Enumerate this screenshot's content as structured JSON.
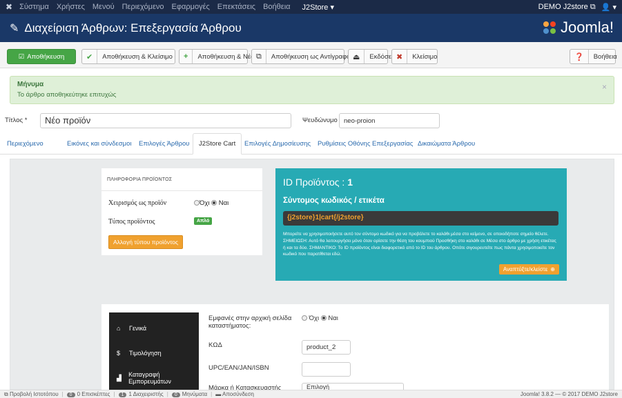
{
  "topnav": {
    "items": [
      "Σύστημα",
      "Χρήστες",
      "Μενού",
      "Περιεχόμενο",
      "Εφαρμογές",
      "Επεκτάσεις",
      "Βοήθεια"
    ],
    "j2store": "J2Store ▾",
    "site": "DEMO J2store",
    "user": "▾"
  },
  "titlebar": {
    "title": "Διαχείριση Άρθρων: Επεξεργασία Άρθρου",
    "logo": "Joomla!"
  },
  "toolbar": {
    "save": "Αποθήκευση",
    "save_close": "Αποθήκευση & Κλείσιμο",
    "save_new": "Αποθήκευση & Νέο",
    "save_copy": "Αποθήκευση ως Αντίγραφο",
    "versions": "Εκδόσεις",
    "close": "Κλείσιμο",
    "help": "Βοήθεια"
  },
  "message": {
    "heading": "Μήνυμα",
    "text": "Το άρθρο αποθηκεύτηκε επιτυχώς"
  },
  "form": {
    "title_label": "Τίτλος *",
    "title_value": "Νέο προϊόν",
    "alias_label": "Ψευδώνυμο",
    "alias_value": "neo-proion"
  },
  "tabs": [
    "Περιεχόμενο",
    "Εικόνες και σύνδεσμοι",
    "Επιλογές Άρθρου",
    "J2Store Cart",
    "Επιλογές Δημοσίευσης",
    "Ρυθμίσεις Οθόνης Επεξεργασίας",
    "Δικαιώματα Άρθρου"
  ],
  "product_info": {
    "heading": "ΠΛΗΡΟΦΟΡΙΑ ΠΡΟΪΟΝΤΟΣ",
    "treat_label": "Χειρισμός ως προϊόν",
    "no": "Όχι",
    "yes": "Ναι",
    "type_label": "Τύπος προϊόντος",
    "type_value": "Απλό",
    "change_type": "Αλλαγή τύπου προϊόντος"
  },
  "id_panel": {
    "id_label": "ID Προϊόντος :",
    "id_value": "1",
    "shortcode_title": "Σύντομος κωδικός / ετικέτα",
    "shortcode": "{j2store}1|cart{/j2store}",
    "note": "Μπορείτε να χρησιμοποιήσετε αυτό τον σύντομο κωδικό για να προβάλετε το καλάθι μέσα στο κείμενο, σε οποιοδήποτε σημείο θέλετε. ΣΗΜΕΙΩΣΗ: Αυτό θα λειτουργήσει μόνο όταν ορίσετε την θέση του κουμπιού Προσθήκη στο καλάθι σε Μέσα στο άρθρο με χρήση ετικέτας ή και τα δύο. ΣΗΜΑΝΤΙΚΟ: Το ID προϊόντος είναι διαφορετικό από το ID του άρθρου. Οπότε σιγουρευτείτε πως πάντα χρησιμοποιείτε τον κωδικό που παρατίθεται εδώ.",
    "expand": "Αναπτύξτε/κλείστε"
  },
  "sidenav": [
    {
      "icon": "home-icon",
      "glyph": "⌂",
      "label": "Γενικά"
    },
    {
      "icon": "dollar-icon",
      "glyph": "$",
      "label": "Τιμολόγηση"
    },
    {
      "icon": "bar-chart-icon",
      "glyph": "▟",
      "label": "Καταγραφή Εμπορευμάτων"
    }
  ],
  "general": {
    "visible_label": "Εμφανές στην αρχική σελίδα καταστήματος:",
    "no": "Όχι",
    "yes": "Ναι",
    "sku_label": "ΚΩΔ",
    "sku_value": "product_2",
    "upc_label": "UPC/EAN/JAN/ISBN",
    "upc_value": "",
    "brand_label": "Μάρκα ή Κατασκευαστής",
    "brand_value": "Επιλογή"
  },
  "status": {
    "view_site": "Προβολή Ιστοτόπου",
    "visitors_count": "0",
    "visitors": "Επισκέπτες",
    "admins_count": "1",
    "admins": "Διαχειριστής",
    "messages_count": "0",
    "messages": "Μηνύματα",
    "logout": "Αποσύνδεση",
    "version": "Joomla! 3.8.2 — © 2017 DEMO J2store"
  },
  "colors": {
    "topnav": "#1b2a47",
    "titlebar": "#1a3867",
    "save_green": "#46a546",
    "teal": "#27aab4",
    "orange": "#f0a12f"
  }
}
